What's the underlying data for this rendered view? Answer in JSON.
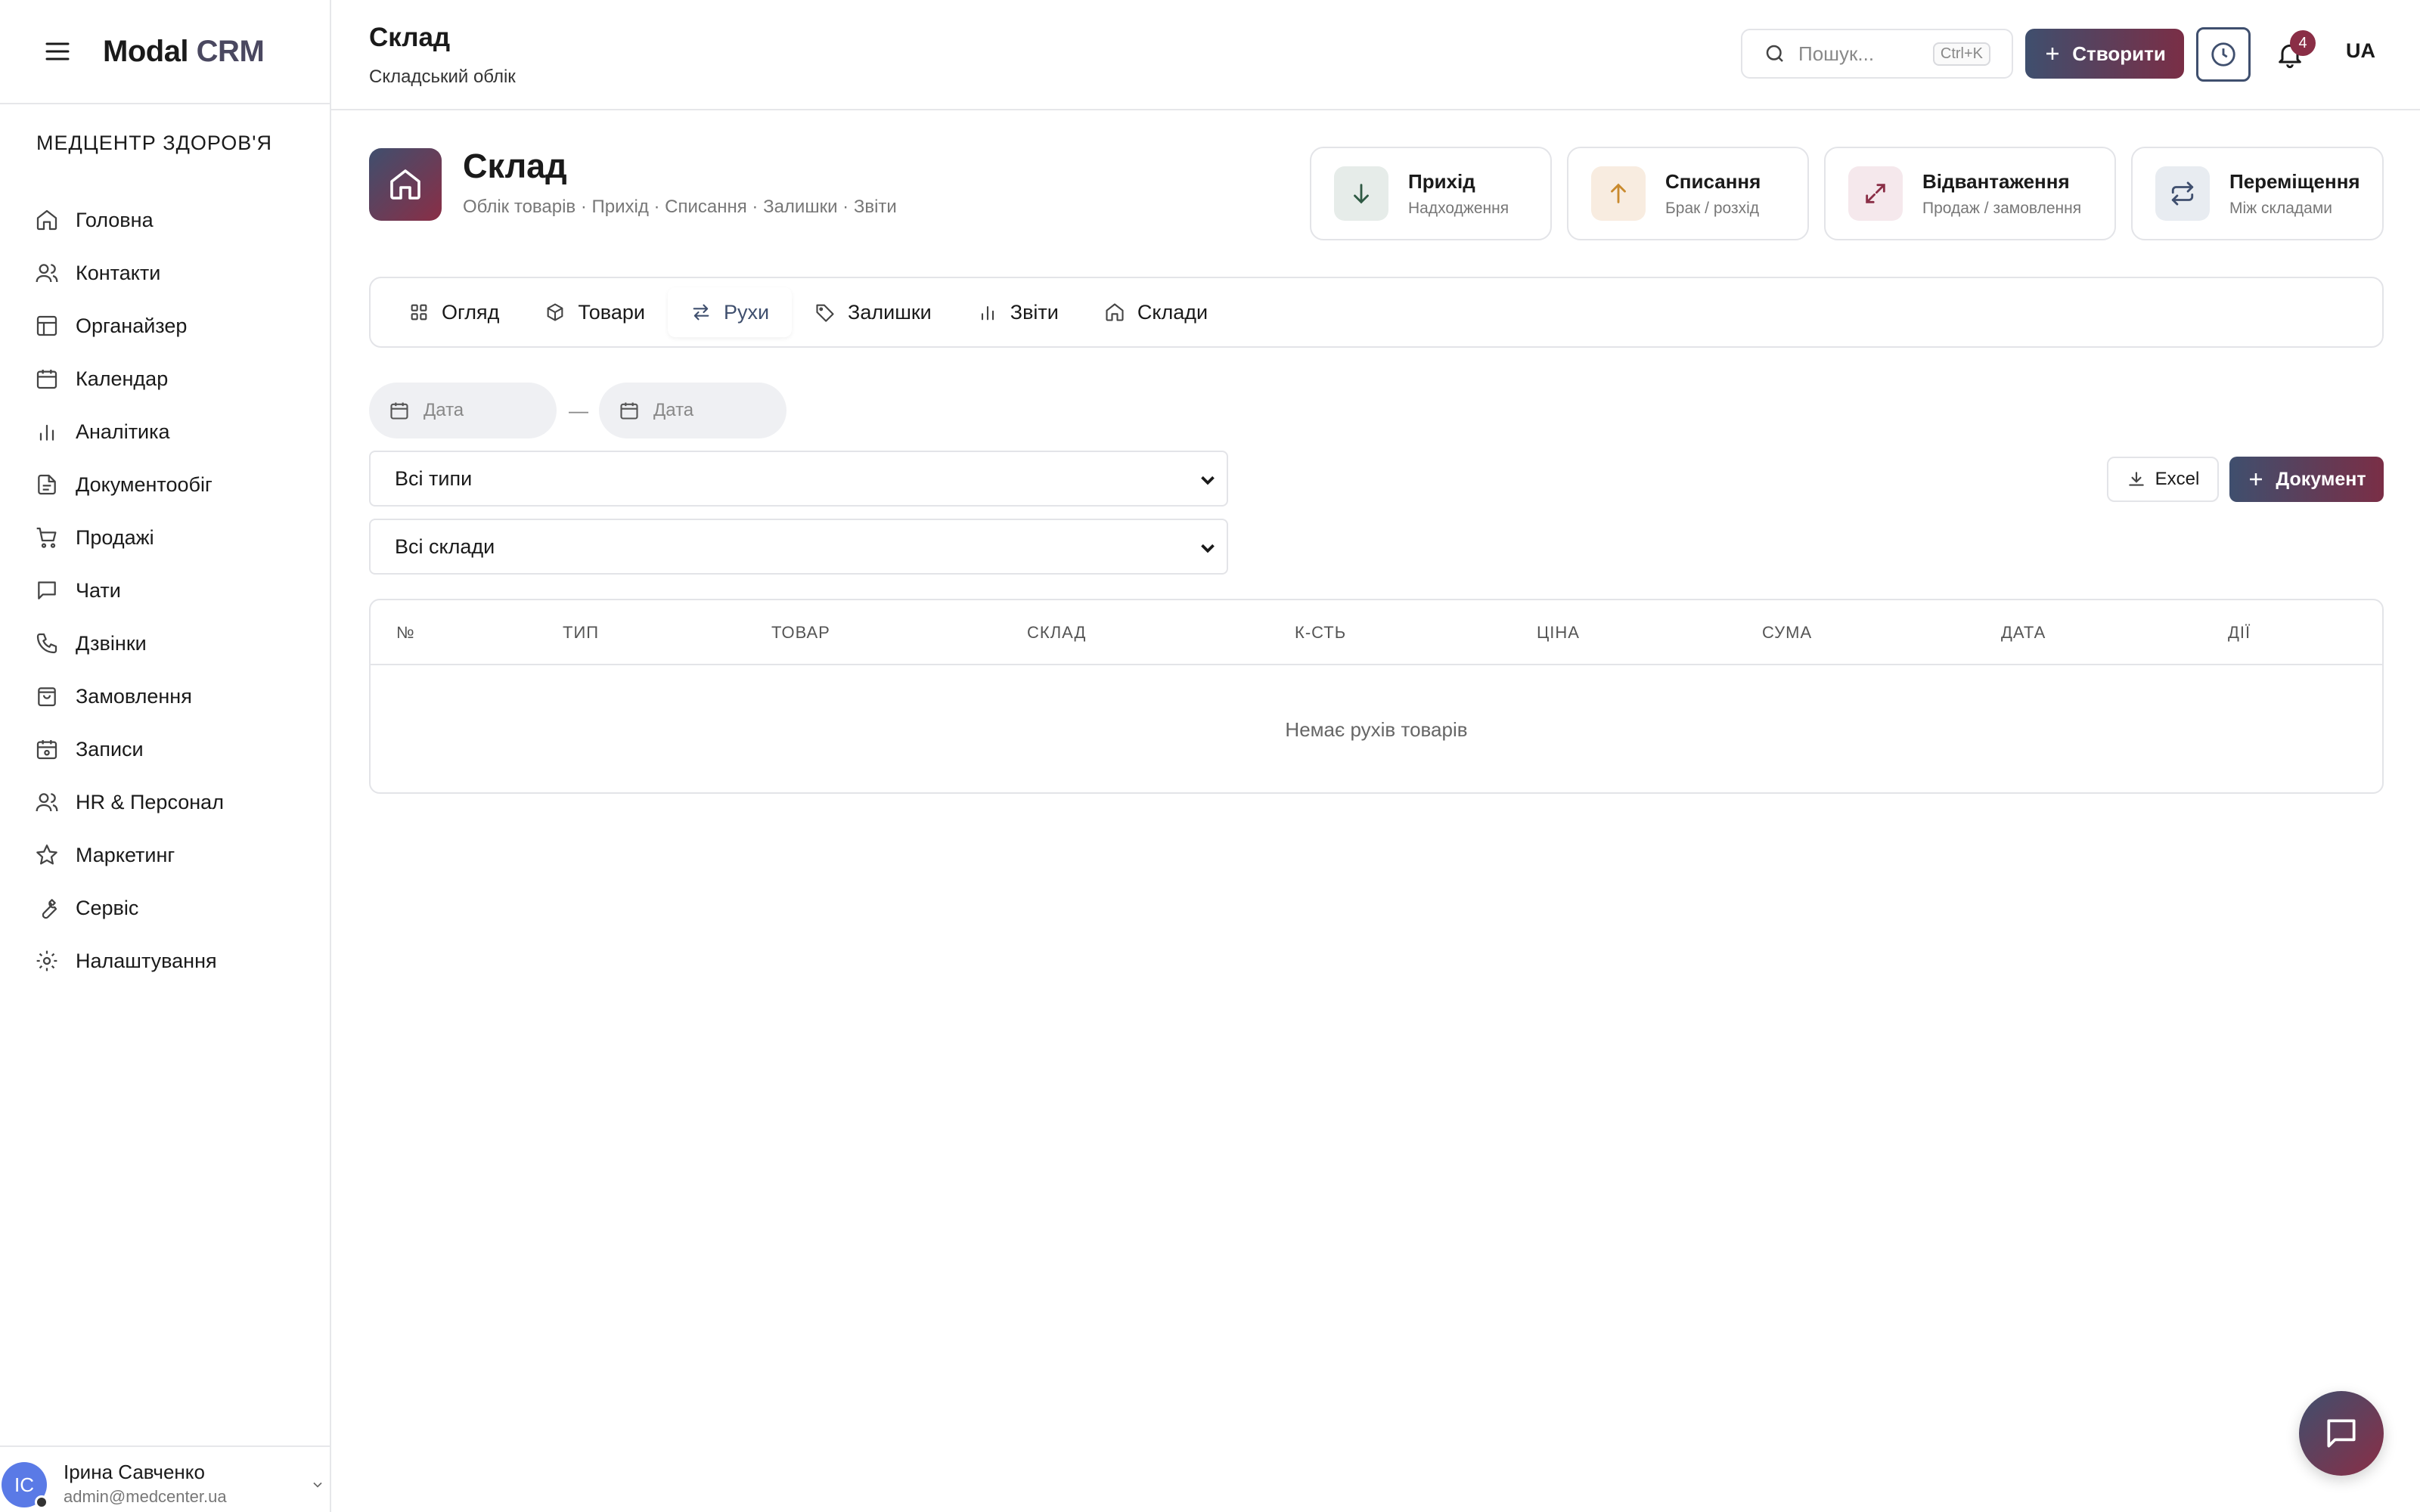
{
  "app": {
    "logo_main": "Modal",
    "logo_accent": "CRM"
  },
  "sidebar": {
    "org": "МЕДЦЕНТР ЗДОРОВ'Я",
    "items": [
      {
        "label": "Головна",
        "icon": "home-icon"
      },
      {
        "label": "Контакти",
        "icon": "users-icon"
      },
      {
        "label": "Органайзер",
        "icon": "layout-icon"
      },
      {
        "label": "Календар",
        "icon": "calendar-icon"
      },
      {
        "label": "Аналітика",
        "icon": "bar-chart-icon"
      },
      {
        "label": "Документообіг",
        "icon": "file-icon"
      },
      {
        "label": "Продажі",
        "icon": "cart-icon"
      },
      {
        "label": "Чати",
        "icon": "chat-icon"
      },
      {
        "label": "Дзвінки",
        "icon": "phone-icon"
      },
      {
        "label": "Замовлення",
        "icon": "bag-icon"
      },
      {
        "label": "Записи",
        "icon": "calendar-check-icon"
      },
      {
        "label": "HR & Персонал",
        "icon": "users-icon"
      },
      {
        "label": "Маркетинг",
        "icon": "star-icon"
      },
      {
        "label": "Сервіс",
        "icon": "wrench-icon"
      },
      {
        "label": "Налаштування",
        "icon": "gear-icon"
      }
    ],
    "user": {
      "initials": "ІС",
      "name": "Ірина Савченко",
      "email": "admin@medcenter.ua"
    }
  },
  "topbar": {
    "title": "Склад",
    "subtitle": "Складський облік",
    "search_placeholder": "Пошук...",
    "search_shortcut": "Ctrl+K",
    "create_label": "Створити",
    "notifications_count": "4",
    "lang": "UA"
  },
  "page": {
    "title": "Склад",
    "subtitle": "Облік товарів · Прихід · Списання · Залишки · Звіти"
  },
  "quick_actions": [
    {
      "title": "Прихід",
      "subtitle": "Надходження",
      "icon": "arrow-down-icon",
      "bg": "#e6ece9",
      "color": "#2f5a44"
    },
    {
      "title": "Списання",
      "subtitle": "Брак / розхід",
      "icon": "arrow-up-icon",
      "bg": "#f8ece0",
      "color": "#c98a2e"
    },
    {
      "title": "Відвантаження",
      "subtitle": "Продаж / замовлення",
      "icon": "expand-icon",
      "bg": "#f5e8ec",
      "color": "#8a2e46"
    },
    {
      "title": "Переміщення",
      "subtitle": "Між складами",
      "icon": "repeat-icon",
      "bg": "#e8ecf1",
      "color": "#3f4f6e"
    }
  ],
  "tabs": [
    {
      "label": "Огляд",
      "icon": "grid-icon"
    },
    {
      "label": "Товари",
      "icon": "box-icon"
    },
    {
      "label": "Рухи",
      "icon": "transfer-icon",
      "active": true
    },
    {
      "label": "Залишки",
      "icon": "tag-icon"
    },
    {
      "label": "Звіти",
      "icon": "bar-chart-icon"
    },
    {
      "label": "Склади",
      "icon": "home-icon"
    }
  ],
  "filters": {
    "date_from_placeholder": "Дата",
    "date_to_placeholder": "Дата",
    "date_separator": "—",
    "type_select": "Всі типи",
    "warehouse_select": "Всі склади",
    "excel_label": "Excel",
    "document_label": "Документ"
  },
  "table": {
    "columns": [
      "№",
      "ТИП",
      "ТОВАР",
      "СКЛАД",
      "К-СТЬ",
      "ЦІНА",
      "СУМА",
      "ДАТА",
      "ДІЇ"
    ],
    "empty_text": "Немає рухів товарів"
  },
  "colors": {
    "accent_dark": "#3f4f6e",
    "accent_wine": "#8a2e46"
  }
}
